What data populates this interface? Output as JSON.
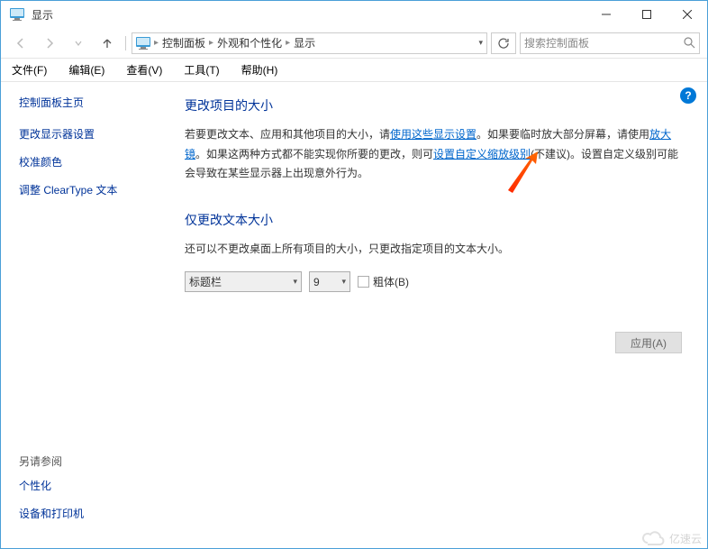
{
  "window": {
    "title": "显示"
  },
  "breadcrumb": {
    "items": [
      "控制面板",
      "外观和个性化",
      "显示"
    ]
  },
  "search": {
    "placeholder": "搜索控制面板"
  },
  "menu": {
    "file": "文件(F)",
    "edit": "编辑(E)",
    "view": "查看(V)",
    "tools": "工具(T)",
    "help": "帮助(H)"
  },
  "sidebar": {
    "home": "控制面板主页",
    "links": [
      "更改显示器设置",
      "校准颜色",
      "调整 ClearType 文本"
    ],
    "see_also_heading": "另请参阅",
    "see_also": [
      "个性化",
      "设备和打印机"
    ]
  },
  "content": {
    "section1": {
      "heading": "更改项目的大小",
      "p1a": "若要更改文本、应用和其他项目的大小，请",
      "link1": "使用这些显示设置",
      "p1b": "。如果要临时放大部分屏幕，请使用",
      "link2": "放大镜",
      "p1c": "。如果这两种方式都不能实现你所要的更改，则可",
      "link3": "设置自定义缩放级别",
      "p1d": "(不建议)。设置自定义级别可能会导致在某些显示器上出现意外行为。"
    },
    "section2": {
      "heading": "仅更改文本大小",
      "p": "还可以不更改桌面上所有项目的大小，只更改指定项目的文本大小。",
      "title_select": "标题栏",
      "size_select": "9",
      "bold_label": "粗体(B)"
    },
    "apply_label": "应用(A)"
  },
  "watermark": "亿速云"
}
